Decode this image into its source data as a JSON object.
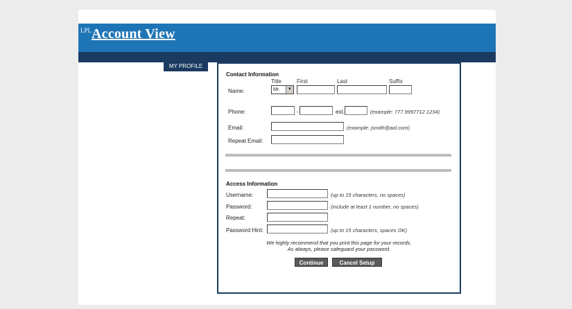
{
  "header": {
    "logo_prefix": "LPL",
    "logo_title": "Account View"
  },
  "nav": {
    "tab_label": "MY PROFILE"
  },
  "contact": {
    "section_title": "Contact Information",
    "columns": {
      "title": "Title",
      "first": "First",
      "last": "Last",
      "suffix": "Suffix"
    },
    "name_label": "Name:",
    "title_value": "Mr.",
    "first_value": "",
    "last_value": "",
    "suffix_value": "",
    "phone_label": "Phone:",
    "phone_dash": "-",
    "phone_ext_label": "ext.",
    "phone_area": "",
    "phone_number": "",
    "phone_ext": "",
    "phone_hint": "(example: 777.9997712 1234)",
    "email_label": "Email:",
    "email_value": "",
    "email_hint": "(example: jsmith@aol.com)",
    "repeat_email_label": "Repeat Email:",
    "repeat_email_value": ""
  },
  "access": {
    "section_title": "Access Information",
    "username_label": "Username:",
    "username_hint": "(up to 15 characters, no spaces)",
    "password_label": "Password:",
    "password_hint": "(include at least 1 number, no spaces)",
    "repeat_label": "Repeat:",
    "password_hint_label": "Password Hint:",
    "password_hint_hint": "(up to 15 characters, spaces OK)"
  },
  "note": {
    "line1": "We highly recommend that you print this page for your records.",
    "line2": "As always, please safeguard your password."
  },
  "buttons": {
    "continue": "Continue",
    "cancel": "Cancel Setup"
  },
  "colors": {
    "header_blue": "#1e75b6",
    "navy": "#1a3a60",
    "button_gray": "#5a5a5a"
  }
}
